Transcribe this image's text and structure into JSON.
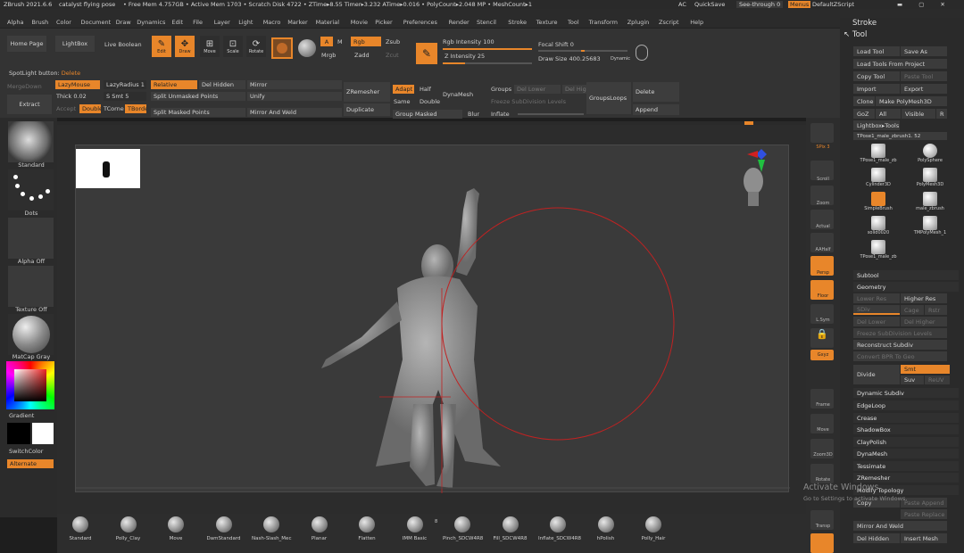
{
  "title_bar": {
    "app": "ZBrush 2021.6.6",
    "doc": "catalyst flying pose",
    "stats": "• Free Mem 4.757GB • Active Mem 1703 • Scratch Disk 4722 • ZTime▸8.55 Timer▸3.232 ATime▸0.016 • PolyCount▸2.048 MP • MeshCount▸1",
    "ac": "AC",
    "quicksave": "QuickSave",
    "see_through": "See-through",
    "see_through_value": "0",
    "menus": "Menus",
    "default_script": "DefaultZScript"
  },
  "menu": [
    "Alpha",
    "Brush",
    "Color",
    "Document",
    "Draw",
    "Dynamics",
    "Edit",
    "File",
    "Layer",
    "Light",
    "Macro",
    "Marker",
    "Material",
    "Movie",
    "Picker",
    "Preferences",
    "Render",
    "Stencil",
    "Stroke",
    "Texture",
    "Tool",
    "Transform",
    "Zplugin",
    "Zscript",
    "Help"
  ],
  "shelf": {
    "home_page": "Home Page",
    "lightbox": "LightBox",
    "live_boolean": "Live Boolean",
    "edit": "Edit",
    "draw": "Draw",
    "move": "Move",
    "scale": "Scale",
    "rotate": "Rotate",
    "a": "A",
    "m": "M",
    "mrgb": "Mrgb",
    "rgb": "Rgb",
    "zadd": "Zadd",
    "zsub": "Zsub",
    "zcut": "Zcut",
    "rgb_intensity_label": "Rgb Intensity",
    "rgb_intensity": "100",
    "rgb_intensity_fill": 1.0,
    "z_intensity_label": "Z Intensity",
    "z_intensity": "25",
    "z_intensity_fill": 0.25,
    "focal_shift_label": "Focal Shift",
    "focal_shift": "0",
    "draw_size_label": "Draw Size",
    "draw_size": "400.25683",
    "dynamic": "Dynamic",
    "spotlight_label": "SpotLight button:",
    "spotlight_value": "Delete",
    "merge_down": "MergeDown",
    "lazymouse": "LazyMouse",
    "lazyradius": "LazyRadius 1",
    "relative": "Relative",
    "del_hidden": "Del Hidden",
    "mirror": "Mirror",
    "extract": "Extract",
    "thick": "Thick",
    "thick_value": "0.02",
    "s_smt": "S Smt 5",
    "split_unmasked": "Split Unmasked Points",
    "unify": "Unify",
    "zremesher": "ZRemesher",
    "adapt": "Adapt",
    "half": "Half",
    "dynamesh": "DynaMesh",
    "groups": "Groups",
    "del_lower": "Del Lower",
    "del_higher": "Del Higher",
    "groups_loops": "GroupsLoops",
    "delete": "Delete",
    "accept": "Accept",
    "double": "Double",
    "tcorne": "TCorne",
    "tborde": "TBorde",
    "split_masked": "Split Masked Points",
    "mirror_and_weld": "Mirror And Weld",
    "duplicate": "Duplicate",
    "same": "Same",
    "double2": "Double",
    "freeze_subdiv": "Freeze SubDivision Levels",
    "group_masked": "Group Masked",
    "blur": "Blur",
    "inflate": "Inflate",
    "append": "Append"
  },
  "left_tray": {
    "standard": "Standard",
    "dots": "Dots",
    "alpha_off": "Alpha Off",
    "texture_off": "Texture Off",
    "matcap": "MatCap Gray",
    "gradient": "Gradient",
    "switch_color": "SwitchColor",
    "alternate": "Alternate"
  },
  "right_shelf": {
    "bpr": "BPR",
    "spix": "SPix",
    "spix_value": "3",
    "scroll": "Scroll",
    "zoom": "Zoom",
    "actual": "Actual",
    "aahalf": "AAHalf",
    "persp": "Persp",
    "floor": "Floor",
    "local": "L.Sym",
    "lock": "",
    "gxyz": "Gxyz",
    "frame": "Frame",
    "move": "Move",
    "zoom3d": "Zoom3D",
    "rotate": "Rotate",
    "transp": "Transp"
  },
  "palette": {
    "stroke": "Stroke",
    "tool": "Tool",
    "load_tool": "Load Tool",
    "save_as": "Save As",
    "load_from_project": "Load Tools From Project",
    "copy_tool": "Copy Tool",
    "paste_tool": "Paste Tool",
    "import": "Import",
    "export": "Export",
    "clone": "Clone",
    "make_polymesh": "Make PolyMesh3D",
    "goz": "GoZ",
    "all": "All",
    "visible": "Visible",
    "r": "R",
    "lightbox_tools": "Lightbox▸Tools",
    "current_tool": "TPose1_male_zbrush1.",
    "current_tool_value": "52",
    "tools": [
      {
        "name": "TPose1_male_zb"
      },
      {
        "name": "PolySphere"
      },
      {
        "name": "Cylinder3D"
      },
      {
        "name": "PolyMesh3D"
      },
      {
        "name": "SimpleBrush"
      },
      {
        "name": "male_zbrush"
      },
      {
        "name": "solid0020"
      },
      {
        "name": "TMPolyMesh_1"
      },
      {
        "name": "TPose1_male_zb"
      }
    ],
    "subtool": "Subtool",
    "geometry": "Geometry",
    "lower_res": "Lower Res",
    "higher_res": "Higher Res",
    "sdiv": "SDiv",
    "cage": "Cage",
    "rstr": "Rstr",
    "del_lower": "Del Lower",
    "del_higher": "Del Higher",
    "freeze_subdiv": "Freeze SubDivision Levels",
    "reconstruct_subdiv": "Reconstruct Subdiv",
    "convert_bpr": "Convert BPR To Geo",
    "divide": "Divide",
    "smt": "Smt",
    "suv": "Suv",
    "reuv": "ReUV",
    "dynamic_subdiv": "Dynamic Subdiv",
    "edgeloop": "EdgeLoop",
    "crease": "Crease",
    "shadowbox": "ShadowBox",
    "claypolish": "ClayPolish",
    "dynamesh": "DynaMesh",
    "tessimate": "Tessimate",
    "zremesher": "ZRemesher",
    "modify_topology": "Modify Topology",
    "copy": "Copy",
    "paste_append": "Paste Append",
    "paste_replace": "Paste Replace",
    "mirror_and_weld": "Mirror And Weld",
    "del_hidden": "Del Hidden",
    "insert_mesh": "Insert Mesh"
  },
  "bottom_brushes": [
    "Standard",
    "Polly_Clay",
    "Move",
    "DamStandard",
    "Nash-Slash_Mec",
    "Planar",
    "Flatten",
    "IMM Basic",
    "Pinch_SDCW4R8",
    "Fill_SDCW4R8",
    "Inflate_SDCW4R8",
    "hPolish",
    "Polly_Hair"
  ],
  "bottom_brush_count": "8",
  "watermark": {
    "line1": "Activate Windows",
    "line2": "Go to Settings to activate Windows."
  },
  "colors": {
    "accent": "#e8862a",
    "panel": "#333333",
    "background": "#1e1e1e"
  }
}
